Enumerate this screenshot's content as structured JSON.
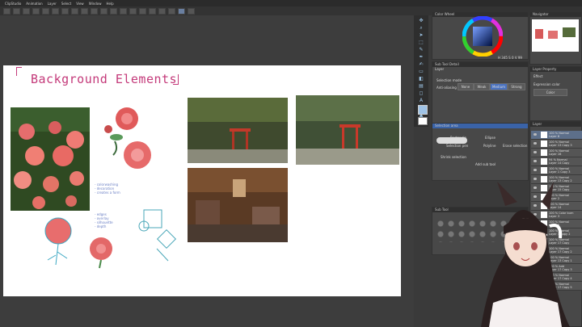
{
  "menu": [
    "ClipStudio",
    "Animation",
    "Layer",
    "Select",
    "View",
    "Window",
    "Help"
  ],
  "canvas": {
    "title": "Background Elements",
    "notes1": [
      "- colorwashing",
      "- decoration",
      "- creates a form"
    ],
    "notes2": [
      "- edges",
      "- overlay",
      "- silhouette",
      "- depth"
    ]
  },
  "panels": {
    "color_wheel": "Color Wheel",
    "navigator": "Navigator",
    "sub_tool": "Sub Tool Detail",
    "layer": "Layer",
    "layer_property": "Layer Property",
    "effect": "Effect",
    "expression_color": "Expression color",
    "color_opt": "Color",
    "selection_mode": "Selection mode",
    "anti_aliasing": "Anti-aliasing",
    "aa_opts": [
      "None",
      "Weak",
      "Medium",
      "Strong"
    ],
    "selection_area": "Selection area",
    "selection_tools": [
      "Rectangle",
      "Ellipse",
      "Polyline",
      "Selection pen",
      "Erase selection"
    ],
    "shrink_selection": "Shrink selection",
    "add_sub_tool": "Add sub tool",
    "sub_tool_panel": "Sub Tool",
    "color_values": "H 345  S 0  V 99"
  },
  "layers": [
    {
      "mode": "100 % Normal",
      "name": "Layer 8"
    },
    {
      "mode": "100 % Normal",
      "name": "Layer 13 Copy 3"
    },
    {
      "mode": "100 % Normal",
      "name": "Layer 16"
    },
    {
      "mode": "94 % Normal",
      "name": "Layer 14 Copy"
    },
    {
      "mode": "100 % Normal",
      "name": "Layer 1 Copy 3"
    },
    {
      "mode": "100 % Normal",
      "name": "Layer 13 Copy 2"
    },
    {
      "mode": "100 % Normal",
      "name": "Layer 15 Copy"
    },
    {
      "mode": "100 % Normal",
      "name": "Layer 2"
    },
    {
      "mode": "100 % Normal",
      "name": "Layer 14"
    },
    {
      "mode": "100 % Color burn",
      "name": "Layer 3"
    },
    {
      "mode": "100 % Normal",
      "name": "Layer 5"
    },
    {
      "mode": "100 % Normal",
      "name": "Layer 1 Copy 2"
    },
    {
      "mode": "100 % Normal",
      "name": "Layer 17 Copy"
    },
    {
      "mode": "100 % Normal",
      "name": "Layer 17 Copy 2"
    },
    {
      "mode": "100 % Normal",
      "name": "Layer 13 Copy 1"
    },
    {
      "mode": "100 % Add",
      "name": "Layer 17 Copy 3"
    },
    {
      "mode": "100 % Normal",
      "name": "Layer 17 Copy 4"
    },
    {
      "mode": "100 % Normal",
      "name": "Layer 17 Copy 5"
    }
  ],
  "colors": {
    "accent": "#4a72c0",
    "title_pink": "#c43a7a"
  }
}
